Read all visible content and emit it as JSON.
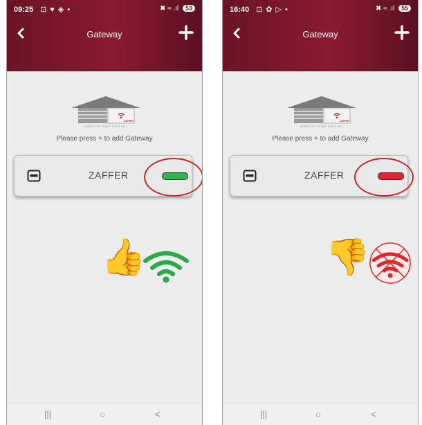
{
  "screens": [
    {
      "status": {
        "time": "09:25",
        "icons": "⊡ ♥ ◈ •",
        "sys": "✖ ≈ .ıl",
        "battery": "53"
      },
      "header": {
        "title": "Gateway"
      },
      "empty_hint": "Please press + to add Gateway",
      "device": {
        "name": "ZAFFER",
        "state": "connected",
        "status_color": "#34b34a"
      },
      "annotation": {
        "reaction": "thumbs-up",
        "wifi_color": "#2aa84a",
        "wifi_crossed": false
      }
    },
    {
      "status": {
        "time": "16:40",
        "icons": "⊡ ✿ ▷ •",
        "sys": "✖ ≈ .ıl",
        "battery": "55"
      },
      "header": {
        "title": "Gateway"
      },
      "empty_hint": "Please press + to add Gateway",
      "device": {
        "name": "ZAFFER",
        "state": "disconnected",
        "status_color": "#e0262a"
      },
      "annotation": {
        "reaction": "thumbs-down",
        "wifi_color": "#e0262a",
        "wifi_crossed": true
      }
    }
  ],
  "nav": {
    "recent": "|||",
    "home": "○",
    "back": "<"
  },
  "logo": {
    "tagline": "WIRELESS HOME COMFORT",
    "brand": "ZAFFER"
  }
}
